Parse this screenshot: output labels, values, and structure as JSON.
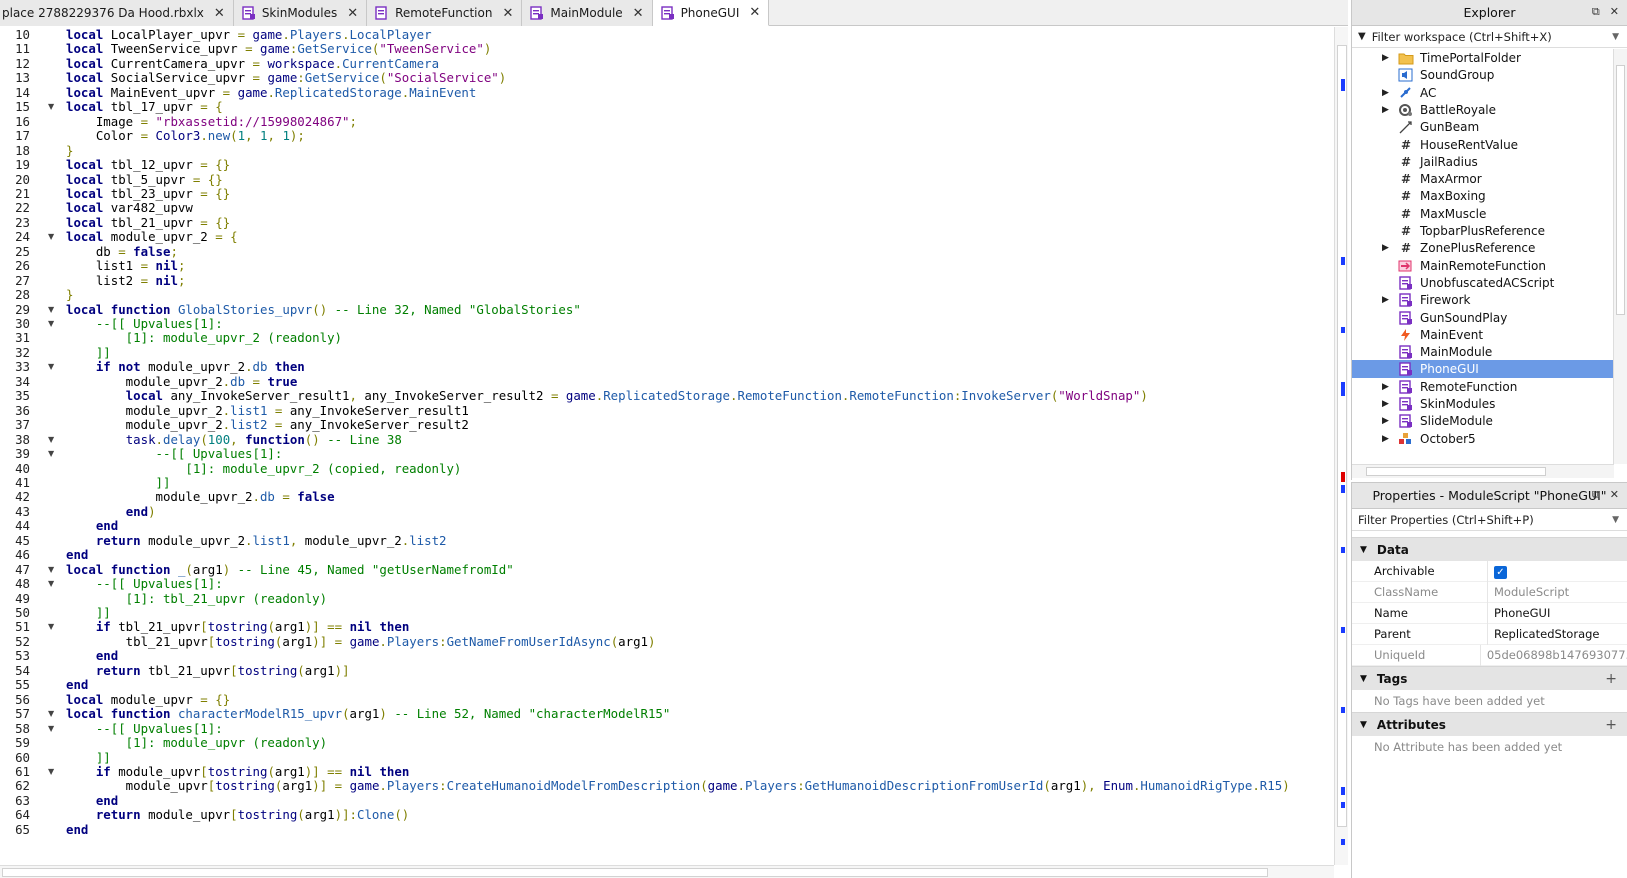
{
  "tabs": [
    {
      "label": "place 2788229376 Da Hood.rbxlx",
      "icon": "none"
    },
    {
      "label": "SkinModules",
      "icon": "module-script-icon"
    },
    {
      "label": "RemoteFunction",
      "icon": "script-icon"
    },
    {
      "label": "MainModule",
      "icon": "module-script-icon"
    },
    {
      "label": "PhoneGUI",
      "icon": "module-script-icon",
      "active": true
    }
  ],
  "editor": {
    "line_numbers": [
      "10",
      "11",
      "12",
      "13",
      "14",
      "15",
      "16",
      "17",
      "18",
      "19",
      "20",
      "21",
      "22",
      "23",
      "24",
      "25",
      "26",
      "27",
      "28",
      "29",
      "30",
      "31",
      "32",
      "33",
      "34",
      "35",
      "36",
      "37",
      "38",
      "39",
      "40",
      "41",
      "42",
      "43",
      "44",
      "45",
      "46",
      "47",
      "48",
      "49",
      "50",
      "51",
      "52",
      "53",
      "54",
      "55",
      "56",
      "57",
      "58",
      "59",
      "60",
      "61",
      "62",
      "63",
      "64",
      "65"
    ],
    "lines": [
      "local LocalPlayer_upvr = game.Players.LocalPlayer",
      "local TweenService_upvr = game:GetService(\"TweenService\")",
      "local CurrentCamera_upvr = workspace.CurrentCamera",
      "local SocialService_upvr = game:GetService(\"SocialService\")",
      "local MainEvent_upvr = game.ReplicatedStorage.MainEvent",
      "local tbl_17_upvr = {",
      "    Image = \"rbxassetid://15998024867\";",
      "    Color = Color3.new(1, 1, 1);",
      "}",
      "local tbl_12_upvr = {}",
      "local tbl_5_upvr = {}",
      "local tbl_23_upvr = {}",
      "local var482_upvw",
      "local tbl_21_upvr = {}",
      "local module_upvr_2 = {",
      "    db = false;",
      "    list1 = nil;",
      "    list2 = nil;",
      "}",
      "local function GlobalStories_upvr() -- Line 32, Named \"GlobalStories\"",
      "    --[[ Upvalues[1]:",
      "        [1]: module_upvr_2 (readonly)",
      "    ]]",
      "    if not module_upvr_2.db then",
      "        module_upvr_2.db = true",
      "        local any_InvokeServer_result1, any_InvokeServer_result2 = game.ReplicatedStorage.RemoteFunction.RemoteFunction:InvokeServer(\"WorldSnap\")",
      "        module_upvr_2.list1 = any_InvokeServer_result1",
      "        module_upvr_2.list2 = any_InvokeServer_result2",
      "        task.delay(100, function() -- Line 38",
      "            --[[ Upvalues[1]:",
      "                [1]: module_upvr_2 (copied, readonly)",
      "            ]]",
      "            module_upvr_2.db = false",
      "        end)",
      "    end",
      "    return module_upvr_2.list1, module_upvr_2.list2",
      "end",
      "local function _(arg1) -- Line 45, Named \"getUserNamefromId\"",
      "    --[[ Upvalues[1]:",
      "        [1]: tbl_21_upvr (readonly)",
      "    ]]",
      "    if tbl_21_upvr[tostring(arg1)] == nil then",
      "        tbl_21_upvr[tostring(arg1)] = game.Players:GetNameFromUserIdAsync(arg1)",
      "    end",
      "    return tbl_21_upvr[tostring(arg1)]",
      "end",
      "local module_upvr = {}",
      "local function characterModelR15_upvr(arg1) -- Line 52, Named \"characterModelR15\"",
      "    --[[ Upvalues[1]:",
      "        [1]: module_upvr (readonly)",
      "    ]]",
      "    if module_upvr[tostring(arg1)] == nil then",
      "        module_upvr[tostring(arg1)] = game.Players:CreateHumanoidModelFromDescription(game.Players:GetHumanoidDescriptionFromUserId(arg1), Enum.HumanoidRigType.R15)",
      "    end",
      "    return module_upvr[tostring(arg1)]:Clone()",
      "end"
    ]
  },
  "explorer": {
    "title": "Explorer",
    "filter_placeholder": "Filter workspace (Ctrl+Shift+X)",
    "items": [
      {
        "label": "TimePortalFolder",
        "icon": "folder-icon",
        "expandable": true
      },
      {
        "label": "SoundGroup",
        "icon": "sound-group-icon",
        "expandable": false
      },
      {
        "label": "AC",
        "icon": "bindable-icon",
        "expandable": true
      },
      {
        "label": "BattleRoyale",
        "icon": "configuration-icon",
        "expandable": true
      },
      {
        "label": "GunBeam",
        "icon": "beam-icon",
        "expandable": false
      },
      {
        "label": "HouseRentValue",
        "icon": "number-value-icon",
        "expandable": false
      },
      {
        "label": "JailRadius",
        "icon": "number-value-icon",
        "expandable": false
      },
      {
        "label": "MaxArmor",
        "icon": "number-value-icon",
        "expandable": false
      },
      {
        "label": "MaxBoxing",
        "icon": "number-value-icon",
        "expandable": false
      },
      {
        "label": "MaxMuscle",
        "icon": "number-value-icon",
        "expandable": false
      },
      {
        "label": "TopbarPlusReference",
        "icon": "number-value-icon",
        "expandable": false
      },
      {
        "label": "ZonePlusReference",
        "icon": "number-value-icon",
        "expandable": true
      },
      {
        "label": "MainRemoteFunction",
        "icon": "remote-function-icon",
        "expandable": false
      },
      {
        "label": "UnobfuscatedACScript",
        "icon": "module-script-icon",
        "expandable": false
      },
      {
        "label": "Firework",
        "icon": "module-script-icon",
        "expandable": true
      },
      {
        "label": "GunSoundPlay",
        "icon": "module-script-icon",
        "expandable": false
      },
      {
        "label": "MainEvent",
        "icon": "remote-event-icon",
        "expandable": false
      },
      {
        "label": "MainModule",
        "icon": "module-script-icon",
        "expandable": false
      },
      {
        "label": "PhoneGUI",
        "icon": "module-script-icon",
        "expandable": false,
        "selected": true
      },
      {
        "label": "RemoteFunction",
        "icon": "module-script-icon",
        "expandable": true
      },
      {
        "label": "SkinModules",
        "icon": "module-script-icon",
        "expandable": true
      },
      {
        "label": "SlideModule",
        "icon": "module-script-icon",
        "expandable": true
      },
      {
        "label": "October5",
        "icon": "model-icon",
        "expandable": true
      }
    ]
  },
  "properties": {
    "title": "Properties - ModuleScript \"PhoneGUI\"",
    "filter_placeholder": "Filter Properties (Ctrl+Shift+P)",
    "data_section": "Data",
    "rows": [
      {
        "name": "Archivable",
        "value": "",
        "checkbox": true
      },
      {
        "name": "ClassName",
        "value": "ModuleScript",
        "readonly": true
      },
      {
        "name": "Name",
        "value": "PhoneGUI"
      },
      {
        "name": "Parent",
        "value": "ReplicatedStorage"
      },
      {
        "name": "UniqueId",
        "value": "05de06898b147693077...",
        "readonly": true
      }
    ],
    "tags_section": "Tags",
    "tags_empty": "No Tags have been added yet",
    "attributes_section": "Attributes",
    "attributes_empty": "No Attribute has been added yet"
  },
  "colors": {
    "keyword": "#00007f",
    "string": "#7f007f",
    "comment": "#007f00",
    "selection": "#6b9ae6",
    "scroll_marker_blue": "#1a3cff",
    "scroll_marker_red": "#e00000"
  }
}
